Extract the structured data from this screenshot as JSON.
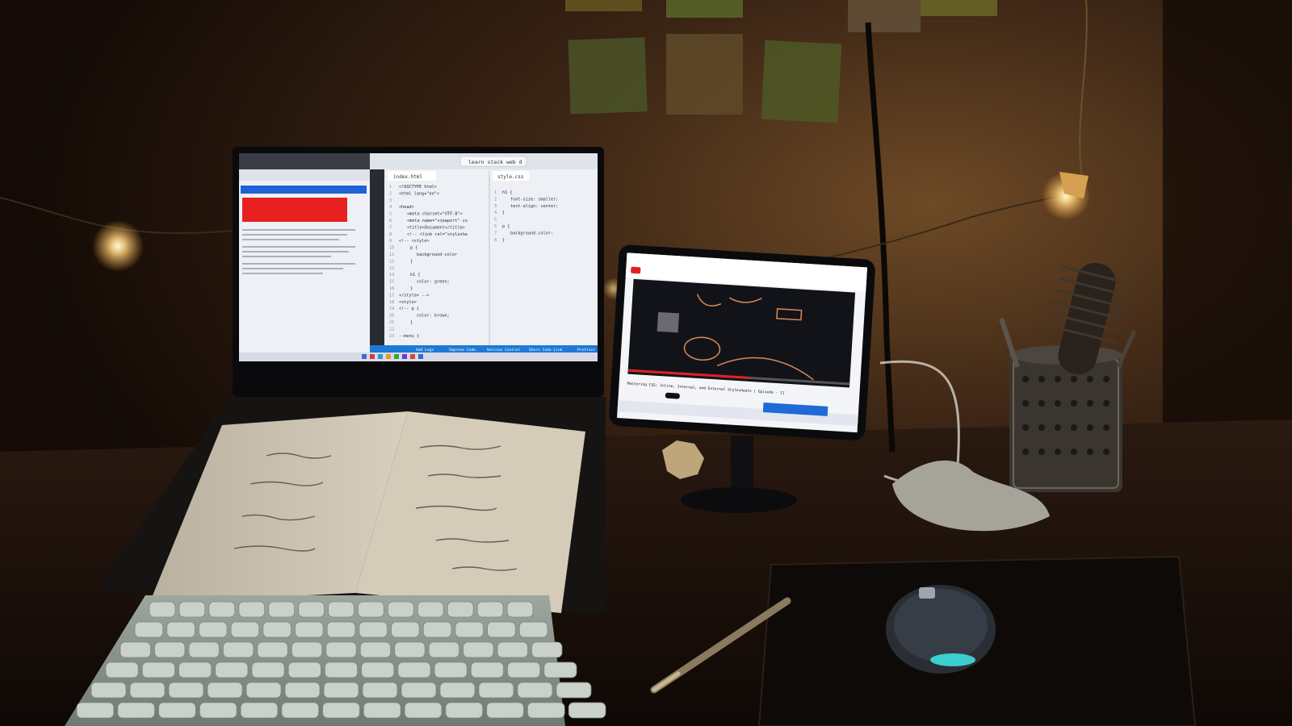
{
  "scene": {
    "colors": {
      "wall_dark": "#1a100a",
      "wall_warm": "#5a3a1e",
      "desk": "#1c120c",
      "screen_light": "#eef0f6",
      "vscode_blue": "#1e7ad6",
      "youtube_red": "#e02020",
      "fairy_light": "#ffd98a"
    }
  },
  "laptop": {
    "code_editor": {
      "tab_html": "index.html",
      "tab_css": "style.css",
      "search_text": "learn stack web d",
      "code_lines": [
        "<!DOCTYPE html>",
        "<html lang=\"en\">",
        "",
        "<head>",
        "<meta charset=\"UTF-8\">",
        "<meta name=\"viewport\" co",
        "<title>Document</title>",
        "<!-- <link rel=\"styleshe",
        "<!-- <style>",
        "p {",
        "background-color",
        "}",
        "",
        "h1 {",
        "color: green;",
        "}",
        "</style> -->",
        "<style>",
        "<!-- p {",
        "color: brown;",
        "}",
        "",
        "--menu {"
      ],
      "css_lines": [
        "h1 {",
        "font-size: smaller;",
        "text-align: center;",
        "}",
        "",
        "p {",
        "background-color:",
        "}"
      ],
      "status_items": [
        "Add Logs",
        "Improve Code",
        "Version Control",
        "Share Code Link",
        "Prettier"
      ]
    }
  },
  "tablet": {
    "video_title": "Mastering CSS: Inline, Internal, and External Stylesheets | Episode - 11"
  }
}
